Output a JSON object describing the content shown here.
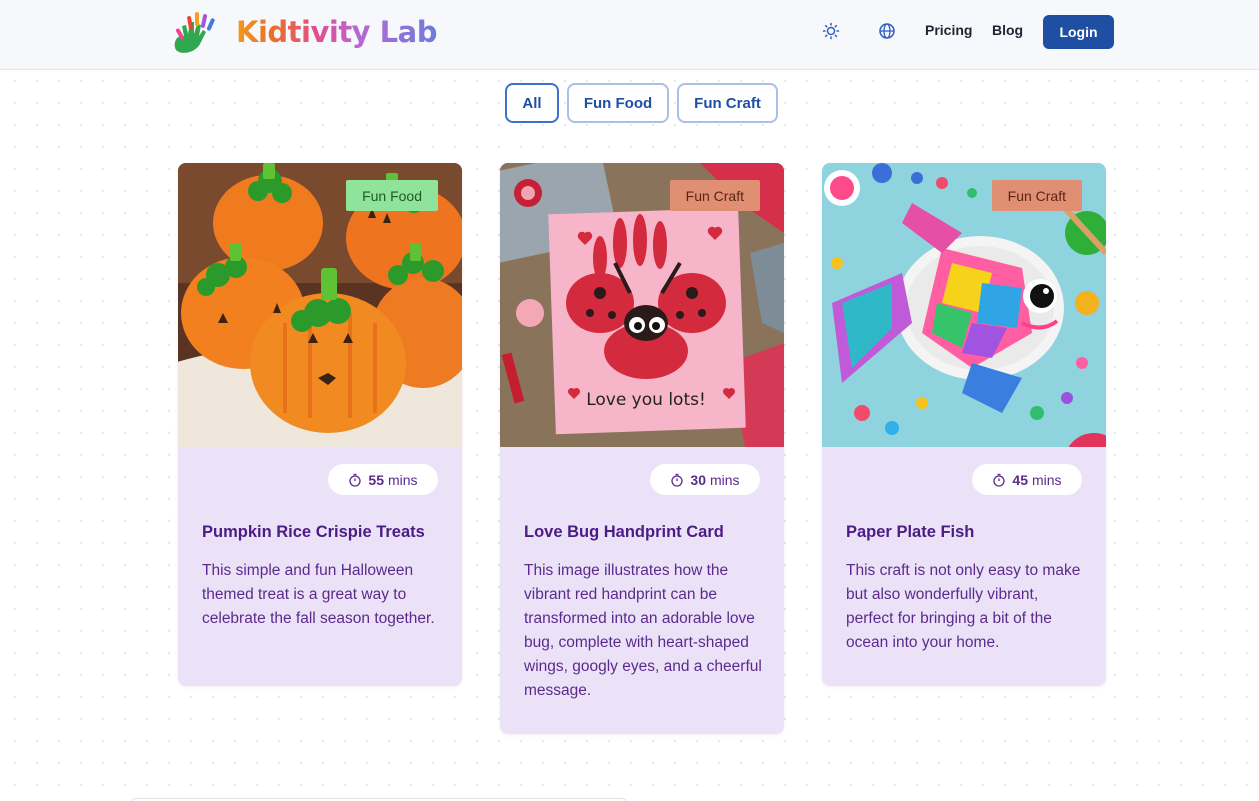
{
  "header": {
    "brand": "Kidtivity Lab",
    "nav": {
      "pricing": "Pricing",
      "blog": "Blog",
      "login": "Login"
    },
    "icons": [
      "sun-icon",
      "globe-icon"
    ]
  },
  "filters": [
    {
      "label": "All",
      "active": true
    },
    {
      "label": "Fun Food",
      "active": false
    },
    {
      "label": "Fun Craft",
      "active": false
    }
  ],
  "time_unit": "mins",
  "cards": [
    {
      "category": "Fun Food",
      "minutes": "55",
      "title": "Pumpkin Rice Crispie Treats",
      "description": "This simple and fun Halloween themed treat is a great way to celebrate the fall season together."
    },
    {
      "category": "Fun Craft",
      "minutes": "30",
      "title": "Love Bug Handprint Card",
      "description": "This image illustrates how the vibrant red handprint can be transformed into an adorable love bug, complete with heart-shaped wings, googly eyes, and a cheerful message."
    },
    {
      "category": "Fun Craft",
      "minutes": "45",
      "title": "Paper Plate Fish",
      "description": "This craft is not only easy to make but also wonderfully vibrant, perfect for bringing a bit of the ocean into your home."
    }
  ],
  "card_image_text": {
    "card2": "Love you lots!"
  },
  "colors": {
    "primary": "#1f4fa3",
    "card_bg": "#ece2f8",
    "title": "#4b1c86",
    "badge_food": "#90e39a",
    "badge_craft": "#e08f72"
  }
}
